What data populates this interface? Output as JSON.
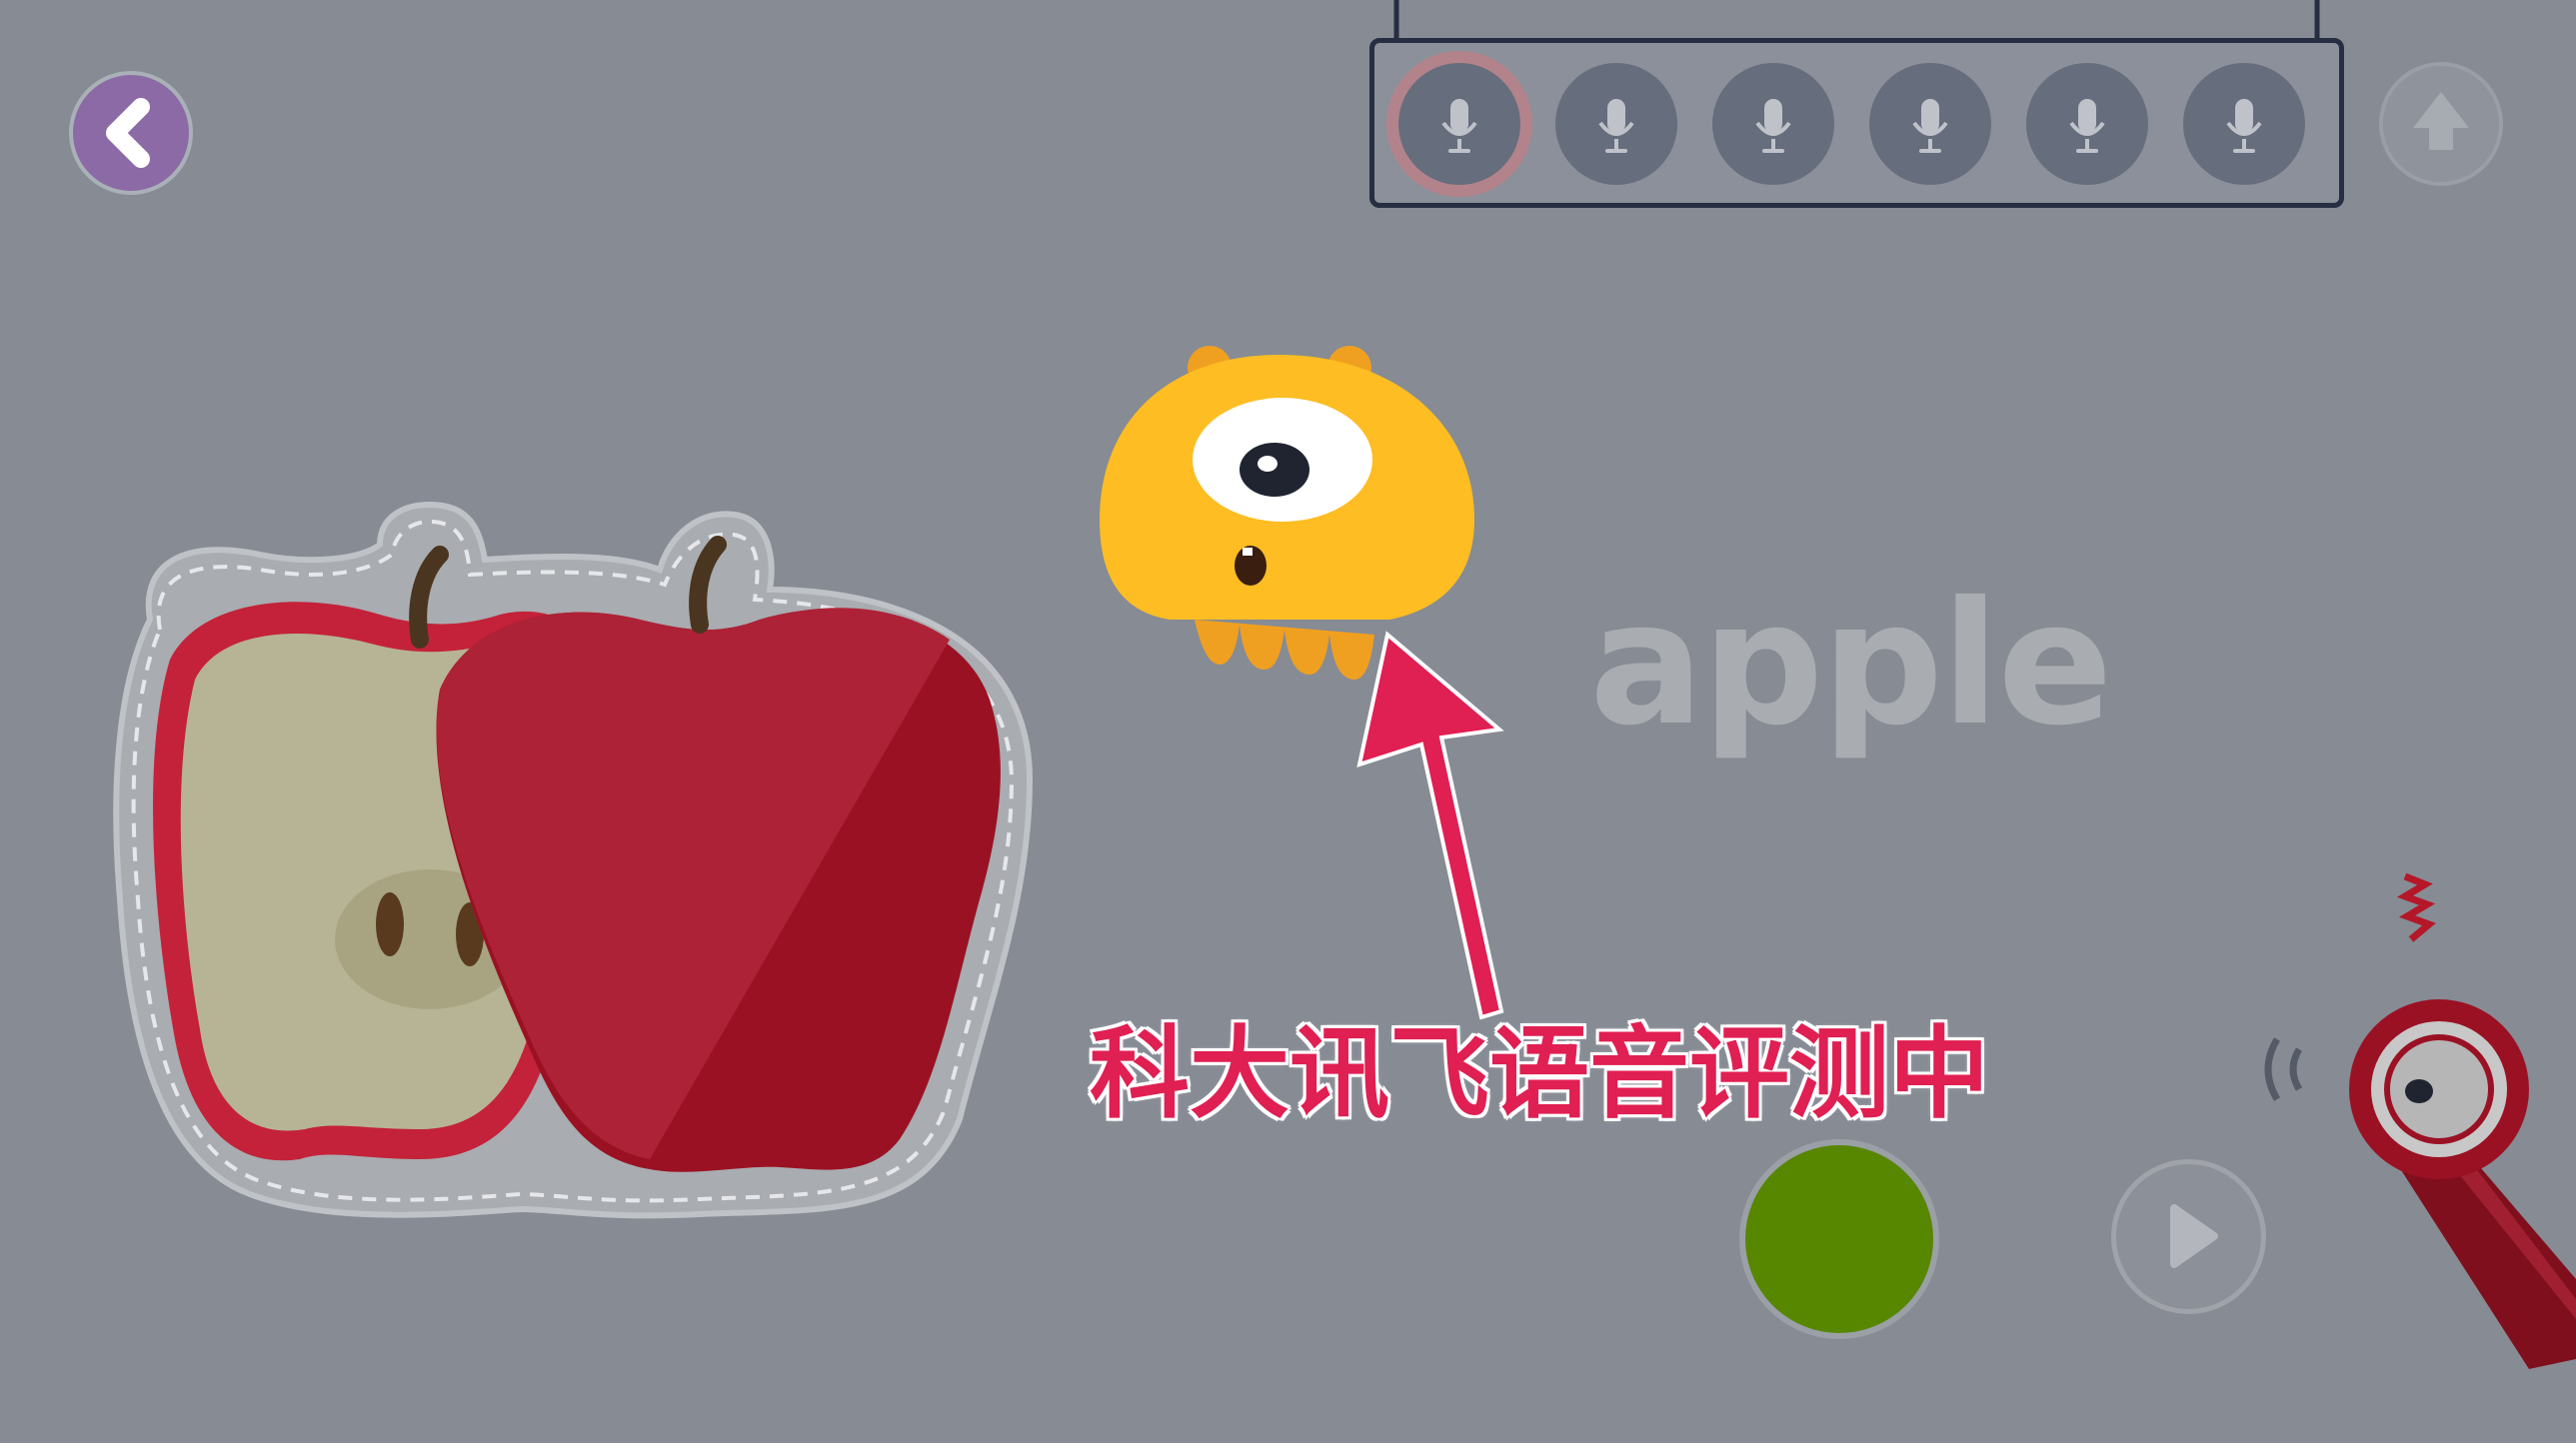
{
  "app": {
    "word": "apple",
    "caption": "科大讯飞语音评测中"
  },
  "toolbar": {
    "back_icon": "chevron-left-icon",
    "upload_icon": "arrow-up-icon",
    "mic_icon": "microphone-icon",
    "mic_slots": 6,
    "active_mic_index": 0
  },
  "controls": {
    "record_icon": "record-circle",
    "play_icon": "play-icon"
  },
  "colors": {
    "background": "#868b94",
    "caption": "#e01f52",
    "record": "#578600",
    "back": "#8c6aa6",
    "monster": "#fdbd23",
    "apple_red": "#9b1124"
  }
}
